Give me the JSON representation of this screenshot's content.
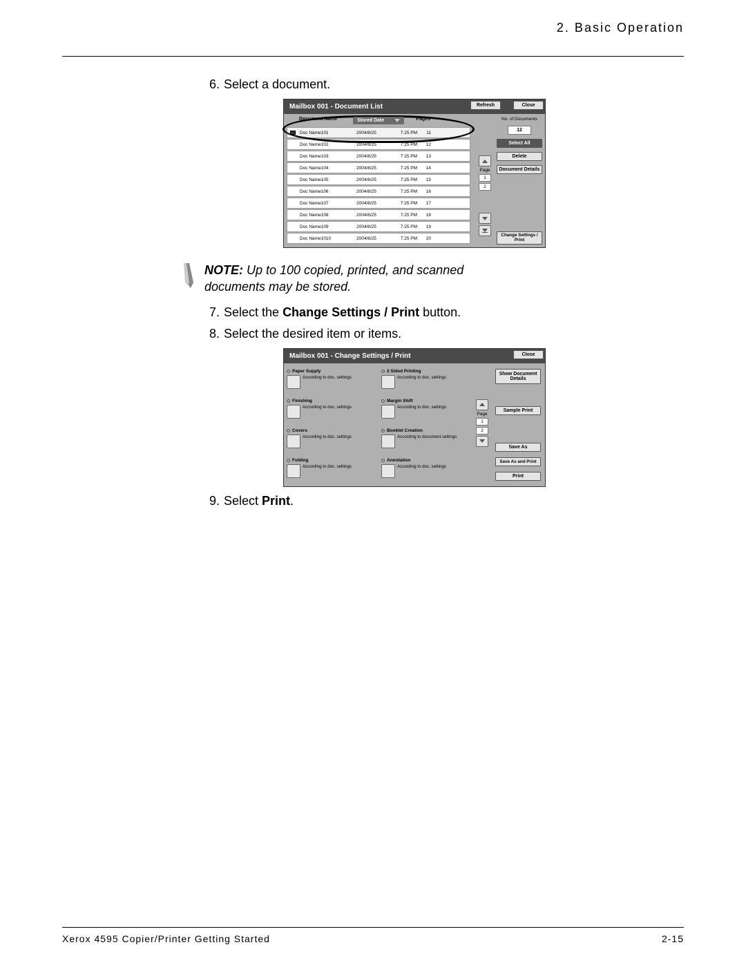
{
  "header": {
    "chapter": "2. Basic Operation"
  },
  "steps": {
    "s6": {
      "num": "6.",
      "text": "Select a document."
    },
    "s7": {
      "num": "7.",
      "pre": "Select the ",
      "bold": "Change Settings / Print",
      "post": " button."
    },
    "s8": {
      "num": "8.",
      "text": "Select the desired item or items."
    },
    "s9": {
      "num": "9.",
      "pre": "Select ",
      "bold": "Print",
      "post": "."
    }
  },
  "note": {
    "label": "NOTE:",
    "body": " Up to 100 copied, printed, and scanned documents may be stored."
  },
  "fig1": {
    "title": "Mailbox 001 - Document List",
    "refresh": "Refresh",
    "close": "Close",
    "headers": {
      "name": "Document Name",
      "date": "Stored Date",
      "pages": "Pages"
    },
    "rows": [
      {
        "name": "Doc Name101",
        "date": "2004/8/25",
        "time": "7:25 PM",
        "pg": "11",
        "sel": true
      },
      {
        "name": "Doc Name102",
        "date": "2004/8/25",
        "time": "7:25 PM",
        "pg": "12"
      },
      {
        "name": "Doc Name103",
        "date": "2004/8/25",
        "time": "7:25 PM",
        "pg": "13"
      },
      {
        "name": "Doc Name104",
        "date": "2004/8/25",
        "time": "7:25 PM",
        "pg": "14"
      },
      {
        "name": "Doc Name105",
        "date": "2004/8/25",
        "time": "7:25 PM",
        "pg": "15"
      },
      {
        "name": "Doc Name106",
        "date": "2004/8/25",
        "time": "7:25 PM",
        "pg": "16"
      },
      {
        "name": "Doc Name107",
        "date": "2004/8/25",
        "time": "7:25 PM",
        "pg": "17"
      },
      {
        "name": "Doc Name108",
        "date": "2004/8/25",
        "time": "7:25 PM",
        "pg": "18"
      },
      {
        "name": "Doc Name109",
        "date": "2004/8/25",
        "time": "7:25 PM",
        "pg": "19"
      },
      {
        "name": "Doc Name1010",
        "date": "2004/8/25",
        "time": "7:25 PM",
        "pg": "20"
      }
    ],
    "page_label": "Page",
    "page_vals": [
      "1",
      "2"
    ],
    "side": {
      "ndocs_label": "No. of Documents",
      "ndocs": "12",
      "select_all": "Select All",
      "delete": "Delete",
      "doc_details": "Document Details",
      "change": "Change Settings / Print"
    }
  },
  "fig2": {
    "title": "Mailbox 001 - Change Settings / Print",
    "close": "Close",
    "opts": [
      {
        "label": "Paper Supply",
        "val": "According to doc. settings"
      },
      {
        "label": "2 Sided Printing",
        "val": "According to doc. settings"
      },
      {
        "label": "Finishing",
        "val": "According to doc. settings"
      },
      {
        "label": "Margin Shift",
        "val": "According to doc. settings"
      },
      {
        "label": "Covers",
        "val": "According to doc. settings"
      },
      {
        "label": "Booklet Creation",
        "val": "According to document settings"
      },
      {
        "label": "Folding",
        "val": "According to doc. settings"
      },
      {
        "label": "Annotation",
        "val": "According to doc. settings"
      }
    ],
    "page_label": "Page",
    "page_vals": [
      "1",
      "2"
    ],
    "side": {
      "show": "Show Document Details",
      "sample": "Sample Print",
      "saveas": "Save As",
      "saveprint": "Save As and Print",
      "print": "Print"
    }
  },
  "footer": {
    "book": "Xerox 4595 Copier/Printer Getting Started",
    "page": "2-15"
  }
}
